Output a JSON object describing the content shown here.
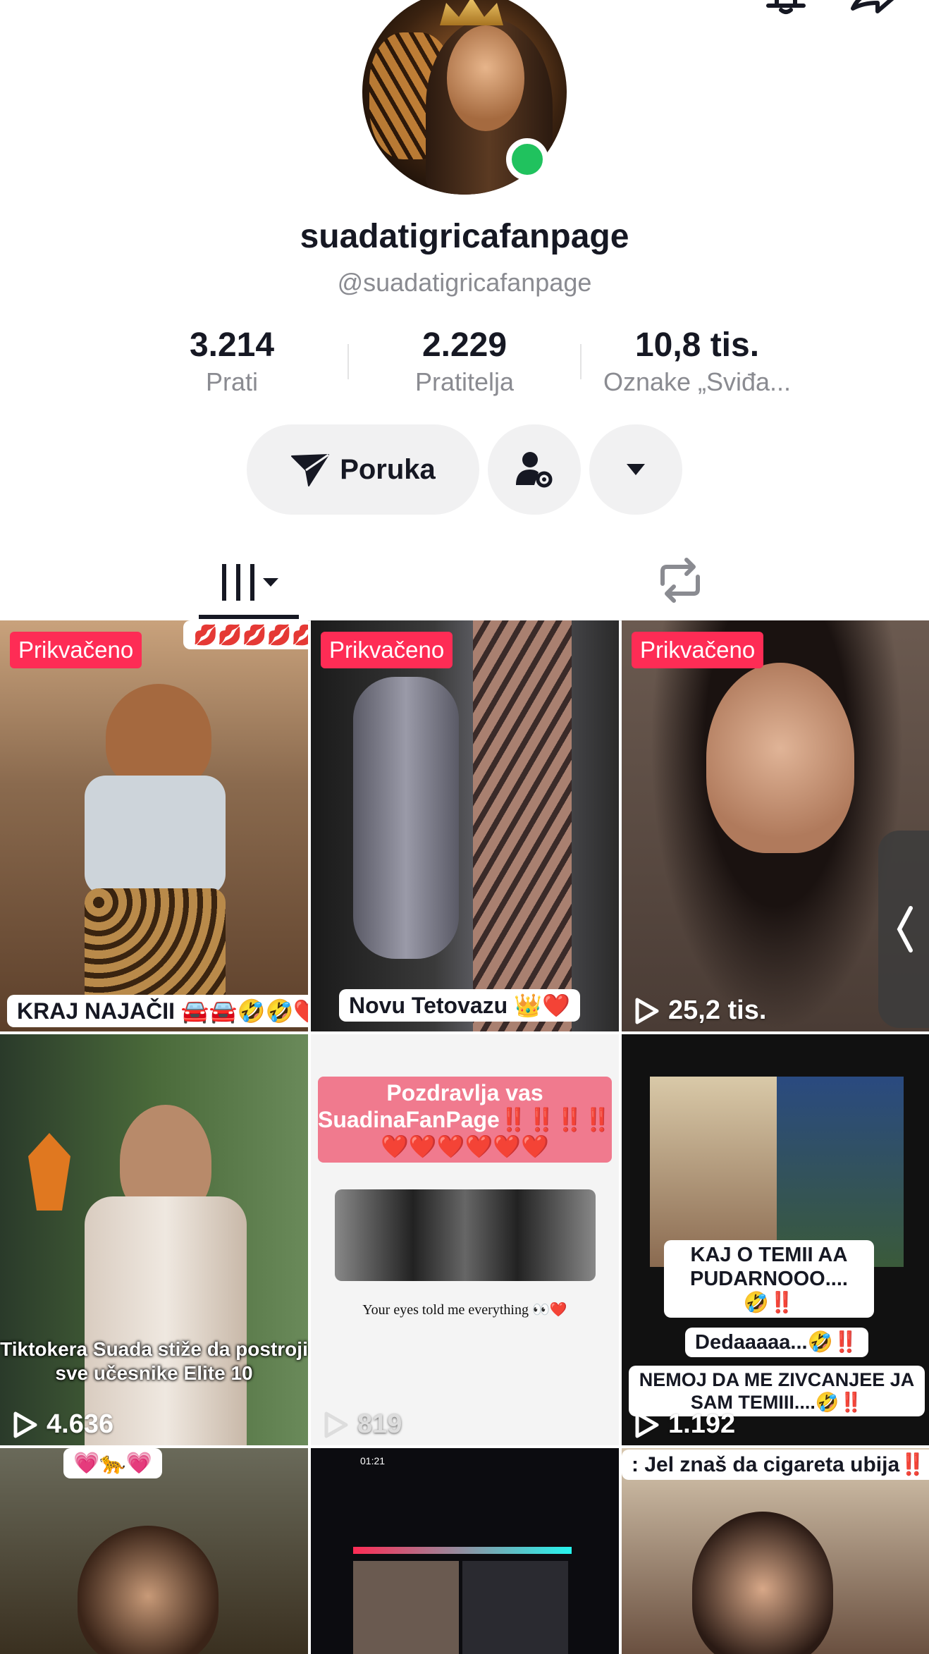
{
  "profile": {
    "name": "suadatigricafanpage",
    "handle": "@suadatigricafanpage",
    "online_color": "#20c25e"
  },
  "stats": [
    {
      "value": "3.214",
      "label": "Prati"
    },
    {
      "value": "2.229",
      "label": "Pratitelja"
    },
    {
      "value": "10,8 tis.",
      "label": "Oznake „Sviđa..."
    }
  ],
  "actions": {
    "message_label": "Poruka"
  },
  "icons": {
    "back": "chevron-left-icon",
    "bell": "bell-icon",
    "share": "share-icon",
    "send": "send-icon",
    "user_settings": "user-settings-icon",
    "more": "caret-down-icon",
    "videos_tab": "grid-tab-icon",
    "repost_tab": "repost-icon",
    "play": "play-icon"
  },
  "accent": "#fe2c55",
  "videos": [
    {
      "pinned": "Prikvačeno",
      "views": "",
      "caption": "KRAJ NAJAČII 🚘🚘🤣🤣❤️",
      "top_caption": "💋💋💋💋💋"
    },
    {
      "pinned": "Prikvačeno",
      "views": "",
      "caption": "Novu Tetovazu 👑❤️",
      "top_caption": ""
    },
    {
      "pinned": "Prikvačeno",
      "views": "25,2 tis.",
      "caption": "",
      "top_caption": ""
    },
    {
      "pinned": "",
      "views": "4.636",
      "caption": "Tiktokera Suada stiže da postroji sve učesnike Elite 10",
      "top_caption": ""
    },
    {
      "pinned": "",
      "views": "819",
      "caption": "Your eyes told me everything 👀❤️",
      "top_caption": "Pozdravlja vas SuadinaFanPage‼️‼️‼️‼️ ❤️❤️❤️❤️❤️❤️"
    },
    {
      "pinned": "",
      "views": "1.192",
      "caption": "NEMOJ DA ME ZIVCANJEE JA SAM TEMIII....🤣‼️",
      "top_caption": "KAJ O TEMII AA PUDARNOOO....🤣‼️",
      "mid_caption": "Dedaaaaa...🤣‼️"
    },
    {
      "pinned": "",
      "views": "",
      "caption": "",
      "top_caption": "💗🐆💗"
    },
    {
      "pinned": "",
      "views": "",
      "caption": "",
      "top_caption": "01:21"
    },
    {
      "pinned": "",
      "views": "",
      "caption": "",
      "top_caption": ": Jel znaš da cigareta ubija‼️"
    }
  ]
}
